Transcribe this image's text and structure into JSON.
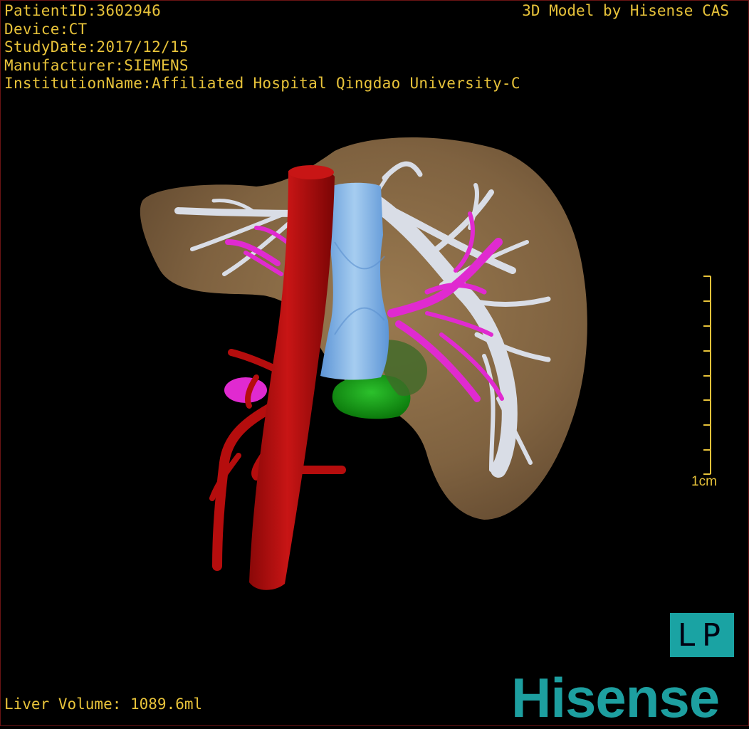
{
  "overlay": {
    "patient_id": "PatientID:3602946",
    "device": "Device:CT",
    "study_date": "StudyDate:2017/12/15",
    "manufacturer": "Manufacturer:SIEMENS",
    "institution": "InstitutionName:Affiliated Hospital Qingdao University-C",
    "model_credit": "3D Model by Hisense CAS",
    "liver_volume": "Liver Volume: 1089.6ml"
  },
  "scale_bar": {
    "label": "1cm"
  },
  "orientation": {
    "label": "LP"
  },
  "logo": {
    "text": "Hisense"
  },
  "colors": {
    "text": "#e8c33a",
    "liver": "#8a6a45",
    "hepatic_vein": "#d9dde6",
    "portal_vein": "#e02ad0",
    "aorta": "#b50d0d",
    "ivc": "#86b8e8",
    "gallbladder": "#1a9e1a",
    "orientation_box": "#1aa3a3",
    "logo": "#1d9fa0"
  }
}
